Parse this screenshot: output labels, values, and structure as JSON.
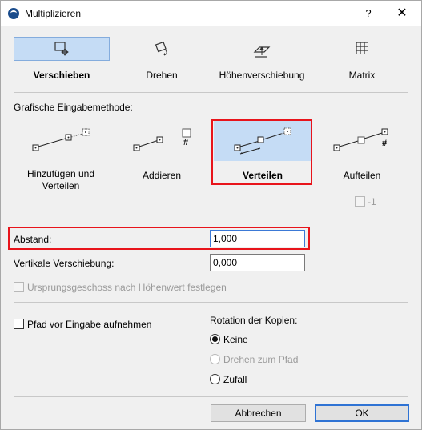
{
  "window": {
    "title": "Multiplizieren",
    "help": "?",
    "close": "✕"
  },
  "tabs": [
    {
      "label": "Verschieben",
      "icon": "move-icon",
      "selected": true
    },
    {
      "label": "Drehen",
      "icon": "rotate-icon",
      "selected": false
    },
    {
      "label": "Höhenverschiebung",
      "icon": "elevate-icon",
      "selected": false
    },
    {
      "label": "Matrix",
      "icon": "matrix-icon",
      "selected": false
    }
  ],
  "input_method": {
    "heading": "Grafische Eingabemethode:",
    "methods": [
      {
        "label": "Hinzufügen und Verteilen",
        "line1": "Hinzufügen und",
        "line2": "Verteilen",
        "icon": "add-distribute-icon",
        "selected": false
      },
      {
        "label": "Addieren",
        "icon": "increment-icon",
        "hash": "#",
        "selected": false
      },
      {
        "label": "Verteilen",
        "icon": "distribute-icon",
        "selected": true
      },
      {
        "label": "Aufteilen",
        "icon": "divide-icon",
        "hash": "#",
        "selected": false
      }
    ],
    "minus_one_label": "-1"
  },
  "fields": {
    "distance_label": "Abstand:",
    "distance_value": "1,000",
    "vertical_label": "Vertikale Verschiebung:",
    "vertical_value": "0,000",
    "origin_story_label": "Ursprungsgeschoss nach Höhenwert festlegen"
  },
  "options": {
    "record_path_label": "Pfad vor Eingabe aufnehmen",
    "rotation_heading": "Rotation der Kopien:",
    "rotation_options": [
      {
        "label": "Keine",
        "checked": true,
        "disabled": false
      },
      {
        "label": "Drehen zum Pfad",
        "checked": false,
        "disabled": true
      },
      {
        "label": "Zufall",
        "checked": false,
        "disabled": false
      }
    ]
  },
  "buttons": {
    "cancel": "Abbrechen",
    "ok": "OK"
  },
  "colors": {
    "selected_bg": "#c5dcf5",
    "highlight": "#e8141b"
  }
}
